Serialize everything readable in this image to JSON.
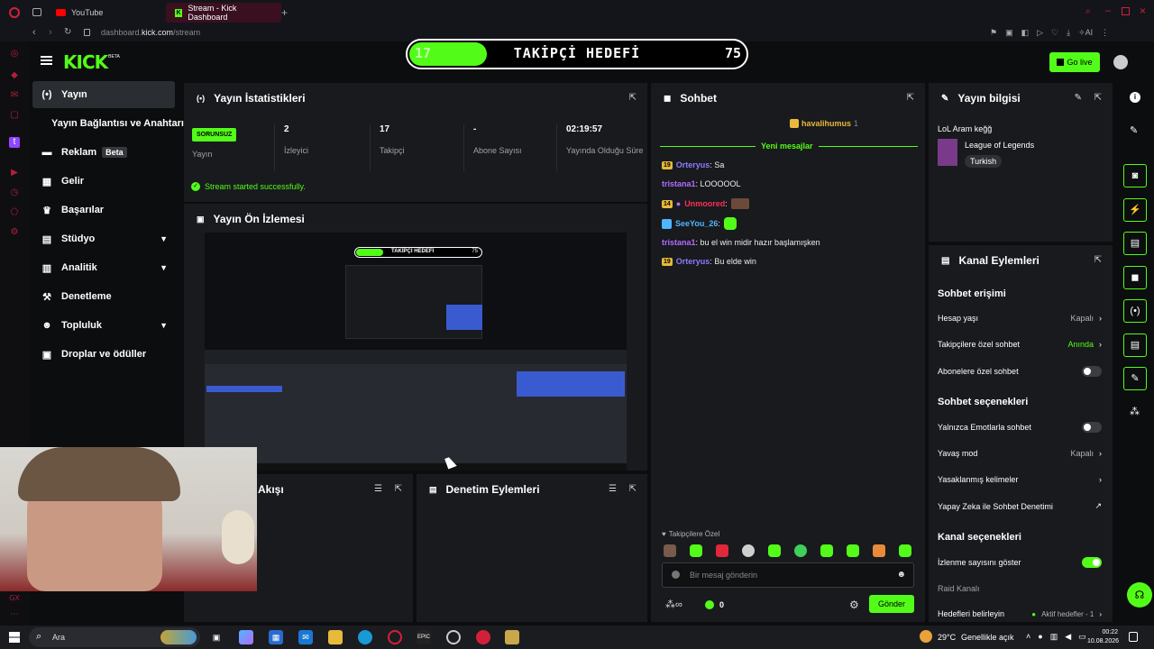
{
  "browser": {
    "tabs": [
      {
        "label": "YouTube"
      },
      {
        "label": "Stream - Kick Dashboard"
      }
    ],
    "url_host": "dashboard.",
    "url_domain": "kick.com",
    "url_path": "/stream"
  },
  "header": {
    "logo": "KICK",
    "logo_sup": "BETA",
    "go_live": "Go live"
  },
  "goal": {
    "current": "17",
    "title": "TAKİPÇİ HEDEFİ",
    "target": "75",
    "progress_fraction": 0.23
  },
  "nav": {
    "items": [
      {
        "label": "Yayın",
        "icon": "broadcast-icon"
      },
      {
        "label": "Yayın Bağlantısı ve Anahtarı"
      },
      {
        "label": "Reklam",
        "badge": "Beta",
        "icon": "ad-icon"
      },
      {
        "label": "Gelir",
        "icon": "revenue-icon"
      },
      {
        "label": "Başarılar",
        "icon": "trophy-icon"
      },
      {
        "label": "Stüdyo",
        "icon": "studio-icon"
      },
      {
        "label": "Analitik",
        "icon": "analytics-icon"
      },
      {
        "label": "Denetleme",
        "icon": "moderation-icon"
      },
      {
        "label": "Topluluk",
        "icon": "community-icon"
      },
      {
        "label": "Droplar ve ödüller",
        "icon": "drops-icon"
      }
    ]
  },
  "stats": {
    "title": "Yayın İstatistikleri",
    "status_badge": "SORUNSUZ",
    "status_label": "Yayın",
    "viewers_value": "2",
    "viewers_label": "İzleyici",
    "followers_value": "17",
    "followers_label": "Takipçi",
    "subs_value": "-",
    "subs_label": "Abone Sayısı",
    "uptime_value": "02:19:57",
    "uptime_label": "Yayında Olduğu Süre",
    "success": "Stream started successfully."
  },
  "preview": {
    "title": "Yayın Ön İzlemesi",
    "inner_goal_title": "TAKİPÇİ HEDEFİ",
    "inner_goal_target": "75"
  },
  "activity": {
    "title": "Akışı"
  },
  "mod_actions": {
    "title": "Denetim Eylemleri"
  },
  "chat": {
    "title": "Sohbet",
    "pinned_user": "havalihumus",
    "pinned_count": "1",
    "new_messages": "Yeni mesajlar",
    "messages": [
      {
        "badge": "19",
        "user": "Orteryus",
        "text": ": Sa",
        "color": "#8c7bff"
      },
      {
        "badge": "",
        "user": "tristana1",
        "text": ": LOOOOOL",
        "color": "#b36bff"
      },
      {
        "badge": "14",
        "user": "Unmoored",
        "text": ":",
        "color": "#ff2d55"
      },
      {
        "badge": "",
        "user": "SeeYou_26",
        "text": ":",
        "color": "#4fb6ff"
      },
      {
        "badge": "",
        "user": "tristana1",
        "text": ": bu el win midir hazır başlamışken",
        "color": "#b36bff"
      },
      {
        "badge": "19",
        "user": "Orteryus",
        "text": ": Bu elde win",
        "color": "#8c7bff"
      }
    ],
    "followers_only": "Takipçilere Özel",
    "input_placeholder": "Bir mesaj gönderin",
    "points": "0",
    "send": "Gönder"
  },
  "info": {
    "title": "Yayın bilgisi",
    "stream_title": "LoL Aram keğğ",
    "category": "League of Legends",
    "language": "Turkish"
  },
  "channel": {
    "title": "Kanal Eylemleri",
    "chat_access": "Sohbet erişimi",
    "account_age": "Hesap yaşı",
    "account_age_val": "Kapalı",
    "followers_chat": "Takipçilere özel sohbet",
    "followers_chat_val": "Anında",
    "subs_chat": "Abonelere özel sohbet",
    "chat_options": "Sohbet seçenekleri",
    "emote_only": "Yalnızca Emotlarla sohbet",
    "slow_mode": "Yavaş mod",
    "slow_mode_val": "Kapalı",
    "banned_words": "Yasaklanmış kelimeler",
    "ai_mod": "Yapay Zeka ile Sohbet Denetimi",
    "channel_options": "Kanal seçenekleri",
    "show_views": "İzlenme sayısını göster",
    "raid": "Raid Kanalı",
    "goals": "Hedefleri belirleyin",
    "goals_val": "Aktif hedefler - 1"
  },
  "taskbar": {
    "search": "Ara",
    "weather": "29°C",
    "weather_text": "Genellikle açık",
    "time": "00:22",
    "date": "10.08.2026"
  },
  "colors": {
    "accent": "#53fc18",
    "panel": "#181a1d",
    "bg": "#0b0d0e"
  }
}
